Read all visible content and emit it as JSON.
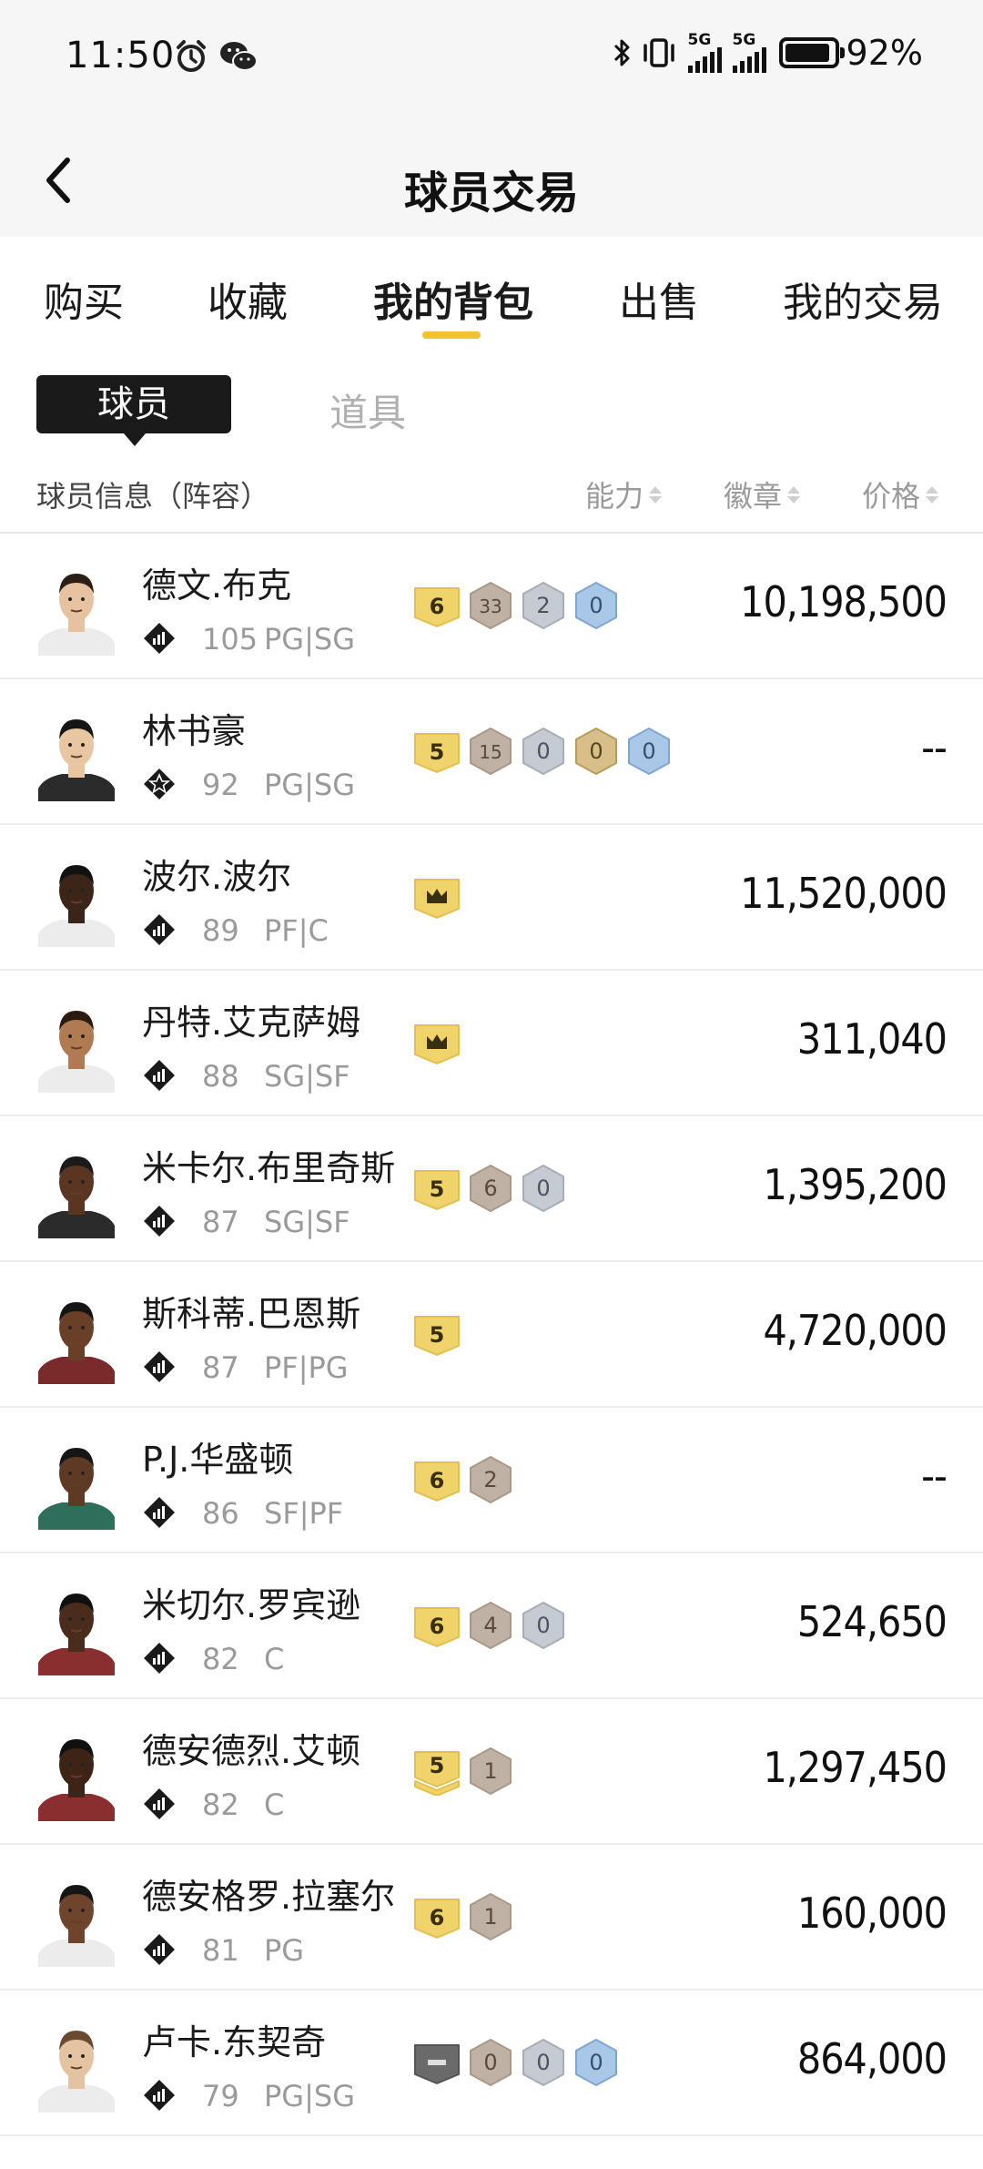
{
  "status_bar": {
    "time": "11:50",
    "battery": "92%",
    "battery_level": 0.92,
    "network_1": "5G",
    "network_2": "5G"
  },
  "nav": {
    "title": "球员交易"
  },
  "tabs": [
    {
      "label": "购买"
    },
    {
      "label": "收藏"
    },
    {
      "label": "我的背包",
      "active": true
    },
    {
      "label": "出售"
    },
    {
      "label": "我的交易"
    }
  ],
  "sub_tabs": {
    "active": "球员",
    "other": "道具"
  },
  "list_header": {
    "info": "球员信息（阵容）",
    "ability": "能力",
    "badge": "徽章",
    "price": "价格"
  },
  "colors": {
    "gold_badge": "#f0d36a",
    "bronze_badge": "#bfb1a4",
    "silver_badge": "#c5cad3",
    "blue_badge": "#a9c7e6",
    "accent": "#f2c230"
  },
  "players": [
    {
      "name": "德文.布克",
      "ovr": "105",
      "pos": "PG|SG",
      "rank_icon": "diamond-rank-icon",
      "badges": [
        {
          "t": "gold",
          "v": "6"
        },
        {
          "t": "bronze",
          "v": "33"
        },
        {
          "t": "silver",
          "v": "2"
        },
        {
          "t": "blue",
          "v": "0"
        }
      ],
      "price": "10,198,500",
      "skin": "#e6c2a0",
      "hair": "#2a1e16",
      "jersey": "#ececec"
    },
    {
      "name": "林书豪",
      "ovr": "92",
      "pos": "PG|SG",
      "rank_icon": "star-rank-icon",
      "badges": [
        {
          "t": "gold",
          "v": "5"
        },
        {
          "t": "bronze",
          "v": "15"
        },
        {
          "t": "silver",
          "v": "0"
        },
        {
          "t": "bronzegold",
          "v": "0"
        },
        {
          "t": "blue",
          "v": "0"
        }
      ],
      "price": "--",
      "skin": "#e8c6a2",
      "hair": "#151515",
      "jersey": "#2b2b2b"
    },
    {
      "name": "波尔.波尔",
      "ovr": "89",
      "pos": "PF|C",
      "rank_icon": "diamond-rank-icon",
      "badges": [
        {
          "t": "crown",
          "v": ""
        }
      ],
      "price": "11,520,000",
      "skin": "#3b2518",
      "hair": "#121212",
      "jersey": "#ececec"
    },
    {
      "name": "丹特.艾克萨姆",
      "ovr": "88",
      "pos": "SG|SF",
      "rank_icon": "diamond-rank-icon",
      "badges": [
        {
          "t": "crown",
          "v": ""
        }
      ],
      "price": "311,040",
      "skin": "#b07a52",
      "hair": "#2a1a10",
      "jersey": "#ececec"
    },
    {
      "name": "米卡尔.布里奇斯",
      "ovr": "87",
      "pos": "SG|SF",
      "rank_icon": "diamond-rank-icon",
      "badges": [
        {
          "t": "gold",
          "v": "5"
        },
        {
          "t": "bronze",
          "v": "6"
        },
        {
          "t": "silver",
          "v": "0"
        }
      ],
      "price": "1,395,200",
      "skin": "#5a3522",
      "hair": "#1a1a1a",
      "jersey": "#2b2b2b"
    },
    {
      "name": "斯科蒂.巴恩斯",
      "ovr": "87",
      "pos": "PF|PG",
      "rank_icon": "diamond-rank-icon",
      "badges": [
        {
          "t": "gold",
          "v": "5"
        }
      ],
      "price": "4,720,000",
      "skin": "#6a3f28",
      "hair": "#151515",
      "jersey": "#7a2a2a"
    },
    {
      "name": "P.J.华盛顿",
      "ovr": "86",
      "pos": "SF|PF",
      "rank_icon": "diamond-rank-icon",
      "badges": [
        {
          "t": "gold",
          "v": "6"
        },
        {
          "t": "bronze",
          "v": "2"
        }
      ],
      "price": "--",
      "skin": "#5e3a24",
      "hair": "#151515",
      "jersey": "#2e6e5a"
    },
    {
      "name": "米切尔.罗宾逊",
      "ovr": "82",
      "pos": "C",
      "rank_icon": "diamond-rank-icon",
      "badges": [
        {
          "t": "gold",
          "v": "6"
        },
        {
          "t": "bronze",
          "v": "4"
        },
        {
          "t": "silver",
          "v": "0"
        }
      ],
      "price": "524,650",
      "skin": "#4a2c1c",
      "hair": "#101010",
      "jersey": "#8a2f2f"
    },
    {
      "name": "德安德烈.艾顿",
      "ovr": "82",
      "pos": "C",
      "rank_icon": "diamond-rank-icon",
      "badges": [
        {
          "t": "gold2",
          "v": "5"
        },
        {
          "t": "bronze",
          "v": "1"
        }
      ],
      "price": "1,297,450",
      "skin": "#3e2416",
      "hair": "#101010",
      "jersey": "#8a2f2f"
    },
    {
      "name": "德安格罗.拉塞尔",
      "ovr": "81",
      "pos": "PG",
      "rank_icon": "diamond-rank-icon",
      "badges": [
        {
          "t": "gold",
          "v": "6"
        },
        {
          "t": "bronze",
          "v": "1"
        }
      ],
      "price": "160,000",
      "skin": "#6e452c",
      "hair": "#151515",
      "jersey": "#ececec"
    },
    {
      "name": "卢卡.东契奇",
      "ovr": "79",
      "pos": "PG|SG",
      "rank_icon": "diamond-rank-icon",
      "badges": [
        {
          "t": "dark",
          "v": ""
        },
        {
          "t": "bronze",
          "v": "0"
        },
        {
          "t": "silver",
          "v": "0"
        },
        {
          "t": "blue",
          "v": "0"
        }
      ],
      "price": "864,000",
      "skin": "#e4c3a3",
      "hair": "#6b4a32",
      "jersey": "#ececec"
    }
  ]
}
